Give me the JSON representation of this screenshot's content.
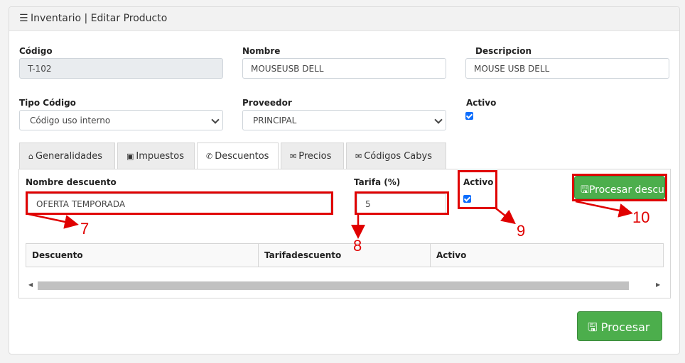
{
  "header": {
    "title": "Inventario | Editar Producto",
    "icon": "list-icon"
  },
  "form": {
    "codigo": {
      "label": "Código",
      "value": "T-102"
    },
    "nombre": {
      "label": "Nombre",
      "value": "MOUSEUSB DELL"
    },
    "descripcion": {
      "label": "Descripcion",
      "value": "MOUSE USB DELL"
    },
    "tipo_codigo": {
      "label": "Tipo Código",
      "value": "Código uso interno"
    },
    "proveedor": {
      "label": "Proveedor",
      "value": "PRINCIPAL"
    },
    "activo": {
      "label": "Activo",
      "checked": true
    }
  },
  "tabs": [
    {
      "label": "Generalidades",
      "icon": "home-icon",
      "active": false
    },
    {
      "label": "Impuestos",
      "icon": "contact-icon",
      "active": false
    },
    {
      "label": "Descuentos",
      "icon": "phone-icon",
      "active": true
    },
    {
      "label": "Precios",
      "icon": "envelope-icon",
      "active": false
    },
    {
      "label": "Códigos Cabys",
      "icon": "envelope-icon",
      "active": false
    }
  ],
  "descuentos": {
    "nombre_label": "Nombre descuento",
    "nombre_value": "OFERTA TEMPORADA",
    "tarifa_label": "Tarifa (%)",
    "tarifa_value": "5",
    "activo_label": "Activo",
    "activo_checked": true,
    "procesar_descuento_label": "Procesar descue",
    "table_headers": [
      "Descuento",
      "Tarifadescuento",
      "Activo"
    ]
  },
  "footer": {
    "procesar_label": "Procesar"
  },
  "annotations": {
    "a7": "7",
    "a8": "8",
    "a9": "9",
    "a10": "10",
    "color": "#e00000"
  },
  "colors": {
    "accent_green": "#4cae4c",
    "checkbox_blue": "#0d6efd"
  }
}
